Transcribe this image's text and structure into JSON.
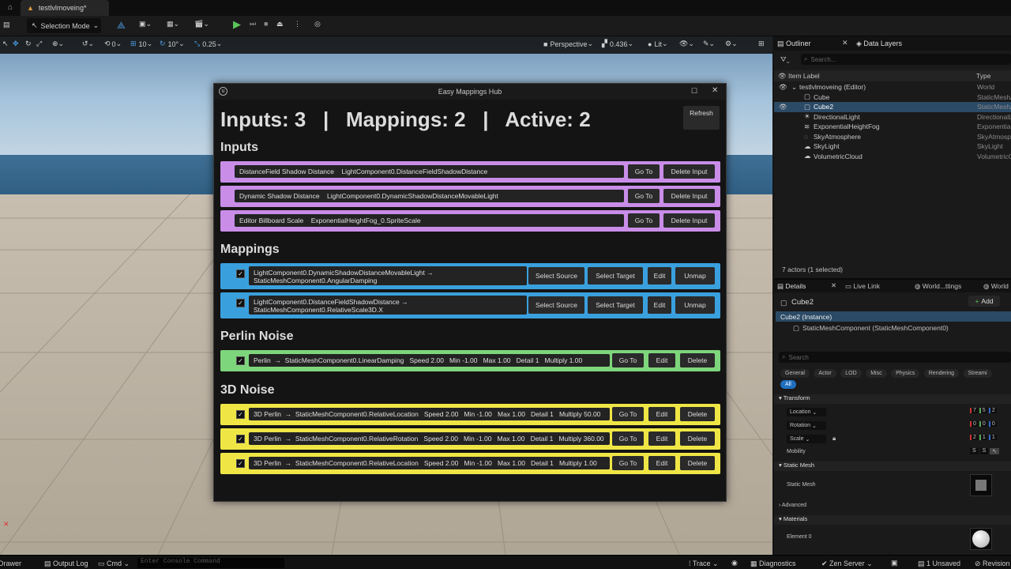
{
  "window": {
    "tab_title": "testlvlmoveing*",
    "selection_mode": "Selection Mode"
  },
  "viewport": {
    "perspective": "Perspective",
    "camera_speed": "0.436",
    "lit": "Lit",
    "grid_move": "10",
    "grid_rotate": "10°",
    "grid_scale": "0.25",
    "zero": "0"
  },
  "outliner": {
    "tab": "Outliner",
    "tab2": "Data Layers",
    "search_placeholder": "Search...",
    "col_label": "Item Label",
    "col_type": "Type",
    "rows": [
      {
        "label": "testlvlmoveing (Editor)",
        "type": "World"
      },
      {
        "label": "Cube",
        "type": "StaticMeshActor"
      },
      {
        "label": "Cube2",
        "type": "StaticMeshActor"
      },
      {
        "label": "DirectionalLight",
        "type": "DirectionalLight"
      },
      {
        "label": "ExponentialHeightFog",
        "type": "ExponentialHeightFog"
      },
      {
        "label": "SkyAtmosphere",
        "type": "SkyAtmosphere"
      },
      {
        "label": "SkyLight",
        "type": "SkyLight"
      },
      {
        "label": "VolumetricCloud",
        "type": "VolumetricCloud"
      }
    ],
    "footer": "7 actors (1 selected)"
  },
  "details": {
    "tab": "Details",
    "tab2": "Live Link",
    "tab3": "World...ttings",
    "tab4": "World",
    "object": "Cube2",
    "add": "Add",
    "instance": "Cube2 (Instance)",
    "component": "StaticMeshComponent (StaticMeshComponent0)",
    "search_placeholder": "Search",
    "filters": [
      "General",
      "Actor",
      "LOD",
      "Misc",
      "Physics",
      "Rendering",
      "Streami"
    ],
    "all": "All",
    "transform": "Transform",
    "location": "Location",
    "rotation": "Rotation",
    "scale": "Scale",
    "mobility": "Mobility",
    "loc_vals": [
      "7",
      "5",
      "2"
    ],
    "rot_vals": [
      "0",
      "0",
      "0"
    ],
    "scale_vals": [
      "2",
      "1",
      "1"
    ],
    "static_mesh_section": "Static Mesh",
    "static_mesh_label": "Static Mesh",
    "advanced": "Advanced",
    "materials": "Materials",
    "element0": "Element 0",
    "mob_s1": "S",
    "mob_s2": "S"
  },
  "hub": {
    "title": "Easy Mappings Hub",
    "summary": "Inputs: 3   |   Mappings: 2   |   Active: 2",
    "refresh": "Refresh",
    "inputs_heading": "Inputs",
    "mappings_heading": "Mappings",
    "perlin_heading": "Perlin Noise",
    "noise3d_heading": "3D Noise",
    "goto": "Go To",
    "delete_input": "Delete Input",
    "select_source": "Select Source",
    "select_target": "Select Target",
    "edit": "Edit",
    "unmap": "Unmap",
    "delete": "Delete",
    "inputs": [
      "DistanceField Shadow Distance    LightComponent0.DistanceFieldShadowDistance",
      "Dynamic Shadow Distance    LightComponent0.DynamicShadowDistanceMovableLight",
      "Editor Billboard Scale    ExponentialHeightFog_0.SpriteScale"
    ],
    "mappings": [
      "LightComponent0.DynamicShadowDistanceMovableLight  →  StaticMeshComponent0.AngularDamping",
      "LightComponent0.DistanceFieldShadowDistance  →  StaticMeshComponent0.RelativeScale3D.X"
    ],
    "perlin": [
      "Perlin  →  StaticMeshComponent0.LinearDamping   Speed 2.00   Min -1.00   Max 1.00   Detail 1   Multiply 1.00"
    ],
    "noise3d": [
      "3D Perlin  →  StaticMeshComponent0.RelativeLocation   Speed 2.00   Min -1.00   Max 1.00   Detail 1   Multiply 50.00",
      "3D Perlin  →  StaticMeshComponent0.RelativeRotation   Speed 2.00   Min -1.00   Max 1.00   Detail 1   Multiply 360.00",
      "3D Perlin  →  StaticMeshComponent0.RelativeLocation   Speed 2.00   Min -1.00   Max 1.00   Detail 1   Multiply 1.00"
    ]
  },
  "statusbar": {
    "content_drawer": "Content Drawer",
    "output_log": "Output Log",
    "cmd": "Cmd",
    "console_placeholder": "Enter Console Command",
    "trace": "Trace",
    "diagnostics": "Diagnostics",
    "zen": "Zen Server",
    "unsaved": "1 Unsaved",
    "revision": "Revision"
  }
}
